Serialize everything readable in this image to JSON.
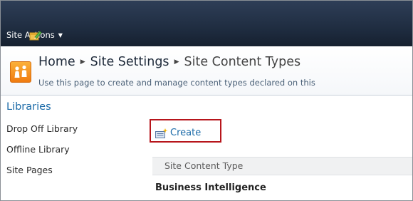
{
  "ribbon": {
    "site_actions_label": "Site Actions",
    "edit_icon": "edit-page-icon"
  },
  "title_area": {
    "logo_icon": "site-logo-icon",
    "breadcrumb": {
      "home": "Home",
      "site_settings": "Site Settings",
      "current": "Site Content Types"
    },
    "description": "Use this page to create and manage content types declared on this"
  },
  "left_nav": {
    "header": "Libraries",
    "items": [
      {
        "label": "Drop Off Library"
      },
      {
        "label": "Offline Library"
      },
      {
        "label": "Site Pages"
      }
    ]
  },
  "toolbar": {
    "create_label": "Create",
    "create_icon": "new-item-icon",
    "highlight_color": "#b7151b"
  },
  "list": {
    "column_header": "Site Content Type",
    "group_heading": "Business Intelligence"
  }
}
